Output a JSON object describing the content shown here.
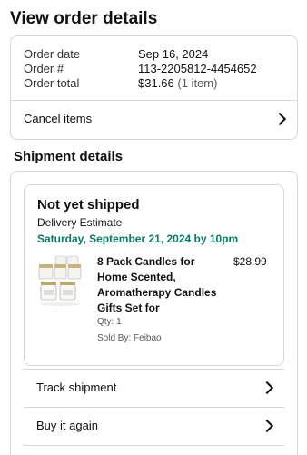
{
  "page": {
    "title": "View order details"
  },
  "order_summary": {
    "rows": [
      {
        "label": "Order date",
        "value": "Sep 16, 2024"
      },
      {
        "label": "Order #",
        "value": "113-2205812-4454652"
      },
      {
        "label": "Order total",
        "value": "$31.66",
        "note": "(1 item)"
      }
    ],
    "cancel_label": "Cancel items"
  },
  "shipment": {
    "section_title": "Shipment details",
    "status": "Not yet shipped",
    "estimate_label": "Delivery Estimate",
    "estimate_date": "Saturday, September 21, 2024 by 10pm",
    "product": {
      "title": "8 Pack Candles for Home Scented, Aromatherapy Candles Gifts Set for",
      "price": "$28.99",
      "qty": "Qty: 1",
      "seller": "Sold By: Feibao",
      "image_icon": "candle-set-product-image"
    },
    "actions": [
      {
        "label": "Track shipment"
      },
      {
        "label": "Buy it again"
      }
    ]
  },
  "colors": {
    "delivery_green": "#067d62",
    "border": "#d5d9d9",
    "text": "#0f1111"
  }
}
